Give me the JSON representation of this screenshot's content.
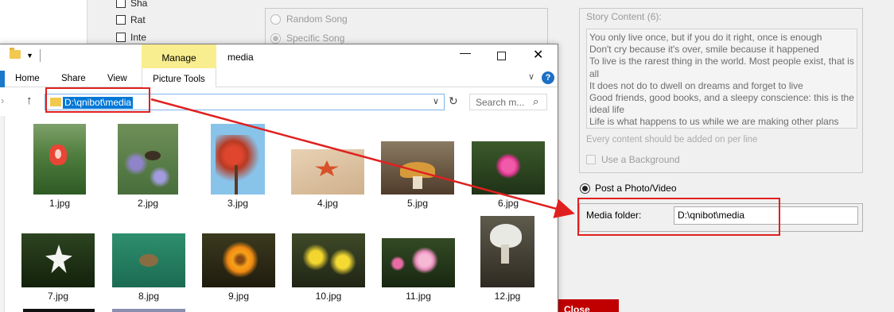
{
  "background": {
    "checkboxes": [
      {
        "label": "Sha"
      },
      {
        "label": "Rat"
      },
      {
        "label": "Inte"
      }
    ],
    "song_options": [
      {
        "label": "Random Song",
        "selected": false
      },
      {
        "label": "Specific Song",
        "selected": true
      }
    ],
    "story": {
      "title": "Story Content (6):",
      "lines": [
        "You only live once, but if you do it right, once is enough",
        "Don't cry because it's over, smile because it happened",
        "To live is the rarest thing in the world. Most people exist, that is all",
        "It does not do to dwell on dreams and forget to live",
        "Good friends, good books, and a sleepy conscience: this is the ideal life",
        "Life is what happens to us while we are making other plans"
      ],
      "hint": "Every content should be added on per line",
      "use_background_label": "Use a Background"
    },
    "post_option_label": "Post a Photo/Video",
    "media_folder_label": "Media folder:",
    "media_folder_value": "D:\\qnibot\\media",
    "close_button_label": "Close"
  },
  "explorer": {
    "title": "media",
    "manage_tab": "Manage",
    "ribbon_tabs": [
      "Home",
      "Share",
      "View"
    ],
    "picture_tools_tab": "Picture Tools",
    "address": "D:\\qnibot\\media",
    "search_placeholder": "Search m...",
    "files": [
      {
        "name": "1.jpg",
        "subject": "red-tulip"
      },
      {
        "name": "2.jpg",
        "subject": "bee-on-lavender"
      },
      {
        "name": "3.jpg",
        "subject": "red-leaves"
      },
      {
        "name": "4.jpg",
        "subject": "starfish-on-sand"
      },
      {
        "name": "5.jpg",
        "subject": "mushroom"
      },
      {
        "name": "6.jpg",
        "subject": "pink-flower"
      },
      {
        "name": "7.jpg",
        "subject": "white-flower"
      },
      {
        "name": "8.jpg",
        "subject": "sea-turtle"
      },
      {
        "name": "9.jpg",
        "subject": "orange-flowers"
      },
      {
        "name": "10.jpg",
        "subject": "yellow-flowers"
      },
      {
        "name": "11.jpg",
        "subject": "pink-flowers"
      },
      {
        "name": "12.jpg",
        "subject": "white-mushroom"
      }
    ]
  },
  "colors": {
    "accent_blue": "#0078d7",
    "callout_red": "#e0201f",
    "manage_yellow": "#f9ee8f",
    "close_red": "#c00000"
  }
}
